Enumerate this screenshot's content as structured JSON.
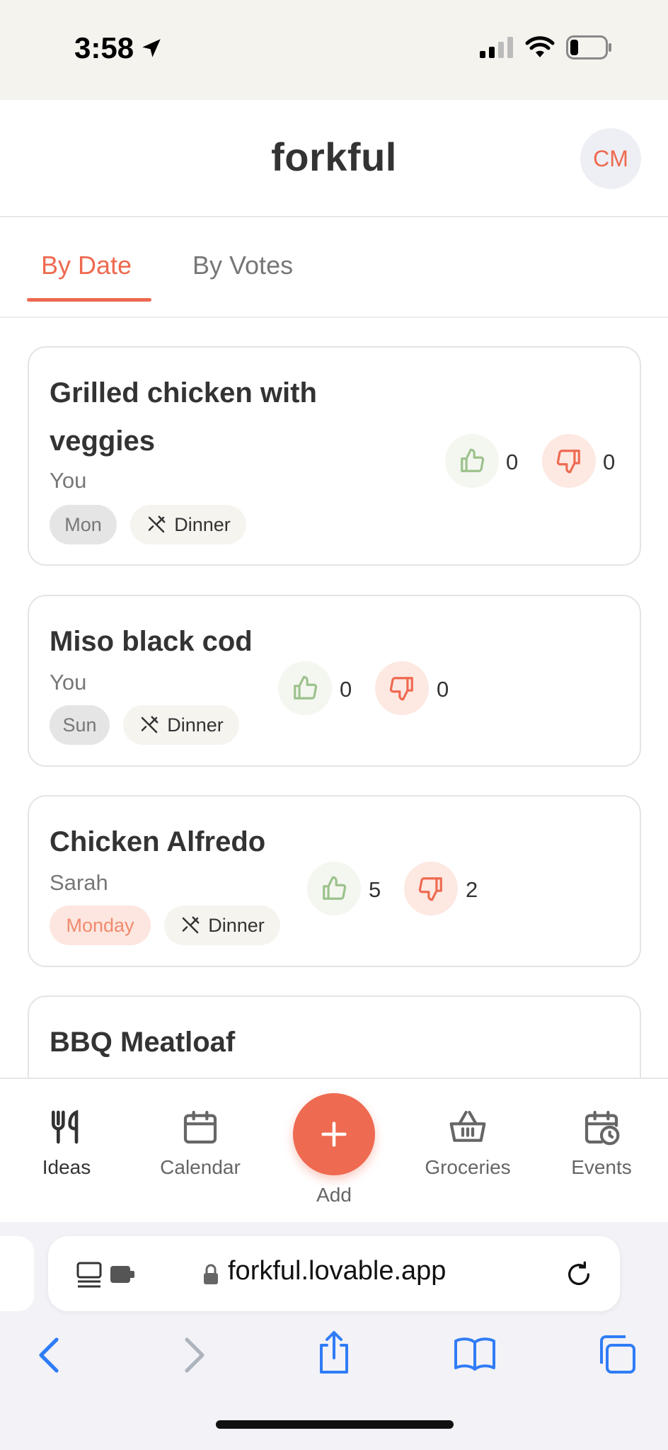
{
  "status_bar": {
    "time": "3:58"
  },
  "header": {
    "app_title": "forkful",
    "avatar_initials": "CM"
  },
  "tabs": [
    {
      "label": "By Date",
      "active": true
    },
    {
      "label": "By Votes",
      "active": false
    }
  ],
  "meals": [
    {
      "title_line1": "Grilled chicken with",
      "title_line2": "veggies",
      "author": "You",
      "day": "Mon",
      "meal_type": "Dinner",
      "upvotes": "0",
      "downvotes": "0"
    },
    {
      "title": "Miso black cod",
      "author": "You",
      "day": "Sun",
      "meal_type": "Dinner",
      "upvotes": "0",
      "downvotes": "0"
    },
    {
      "title": "Chicken Alfredo",
      "author": "Sarah",
      "day": "Monday",
      "meal_type": "Dinner",
      "upvotes": "5",
      "downvotes": "2"
    },
    {
      "title": "BBQ Meatloaf"
    }
  ],
  "bottom_nav": {
    "ideas": "Ideas",
    "calendar": "Calendar",
    "add": "Add",
    "groceries": "Groceries",
    "events": "Events"
  },
  "browser": {
    "url": "forkful.lovable.app"
  },
  "colors": {
    "accent": "#ee6a50",
    "upvote": "#9cc28c",
    "downvote": "#ee6a50"
  }
}
